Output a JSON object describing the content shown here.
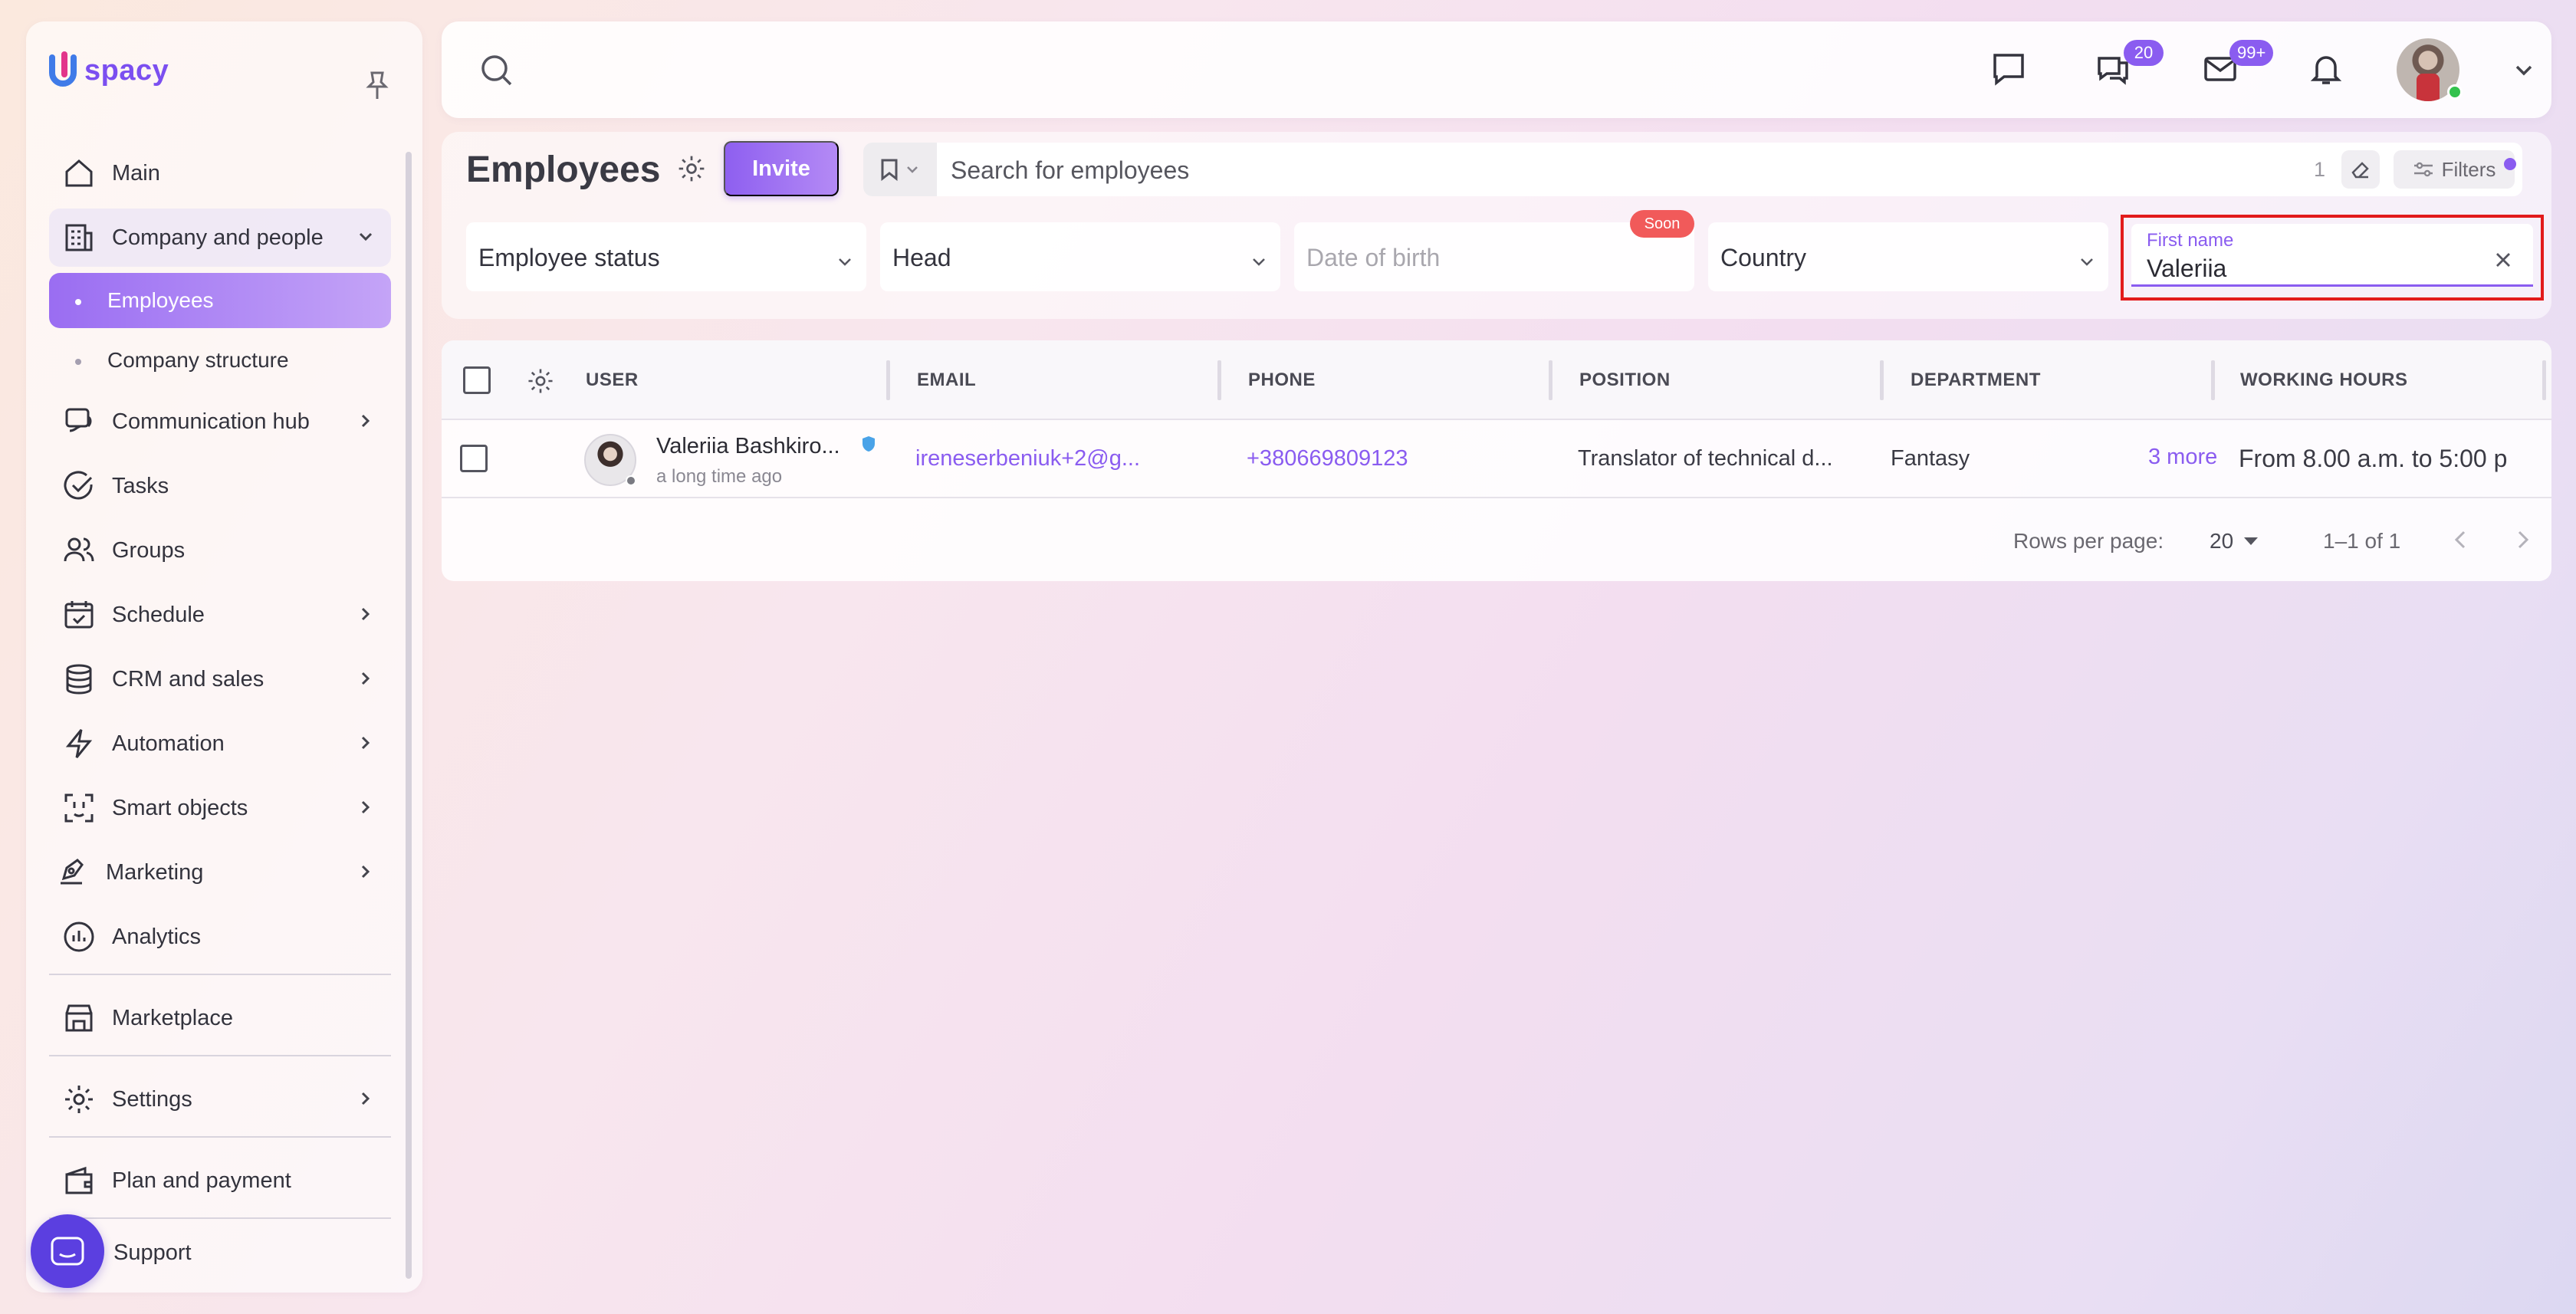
{
  "app": {
    "logo_text": "spacy",
    "brand_color": "#8a5cf0"
  },
  "sidebar": {
    "items": [
      {
        "label": "Main",
        "icon": "home-icon"
      },
      {
        "label": "Company and people",
        "icon": "building-icon",
        "expanded": true
      },
      {
        "label": "Employees",
        "sub": true,
        "active": true
      },
      {
        "label": "Company structure",
        "sub": true
      },
      {
        "label": "Communication hub",
        "icon": "chat-hub-icon"
      },
      {
        "label": "Tasks",
        "icon": "check-circle-icon"
      },
      {
        "label": "Groups",
        "icon": "users-icon"
      },
      {
        "label": "Schedule",
        "icon": "calendar-icon"
      },
      {
        "label": "CRM and sales",
        "icon": "database-icon"
      },
      {
        "label": "Automation",
        "icon": "lightning-icon"
      },
      {
        "label": "Smart objects",
        "icon": "scan-face-icon"
      },
      {
        "label": "Marketing",
        "icon": "megaphone-icon"
      },
      {
        "label": "Analytics",
        "icon": "chart-icon"
      },
      {
        "label": "Marketplace",
        "icon": "store-icon"
      },
      {
        "label": "Settings",
        "icon": "gear-icon"
      },
      {
        "label": "Plan and payment",
        "icon": "wallet-icon"
      },
      {
        "label": "Support",
        "icon": "support-chat-icon"
      }
    ]
  },
  "topbar": {
    "chats_badge": "20",
    "mail_badge": "99+"
  },
  "header": {
    "title": "Employees",
    "invite_label": "Invite",
    "search_placeholder": "Search for employees",
    "search_count": "1",
    "filters_label": "Filters"
  },
  "filters": {
    "employee_status": "Employee status",
    "head": "Head",
    "date_of_birth": "Date of birth",
    "soon_badge": "Soon",
    "country": "Country",
    "first_name_label": "First name",
    "first_name_value": "Valeriia"
  },
  "table": {
    "columns": [
      "USER",
      "EMAIL",
      "PHONE",
      "POSITION",
      "DEPARTMENT",
      "WORKING HOURS"
    ],
    "rows": [
      {
        "name": "Valeriia Bashkiro...",
        "seen": "a long time ago",
        "email": "ireneserbeniuk+2@g...",
        "phone": "+380669809123",
        "position": "Translator of technical d...",
        "department": "Fantasy",
        "department_more": "3 more",
        "working_hours": "From 8.00 a.m. to 5:00 p"
      }
    ],
    "footer": {
      "rows_per_page_label": "Rows per page:",
      "rows_per_page_value": "20",
      "range": "1–1 of 1"
    }
  }
}
